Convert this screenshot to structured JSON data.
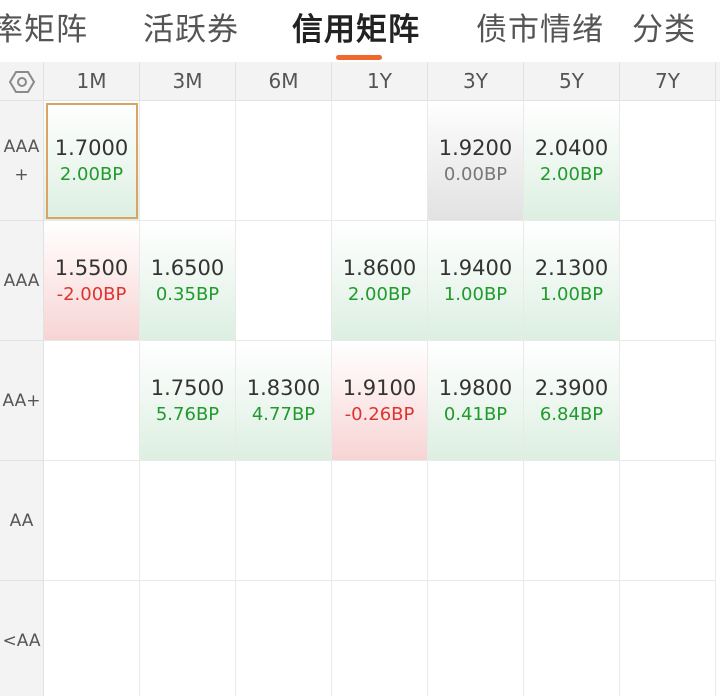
{
  "tabs": [
    {
      "label": "率矩阵"
    },
    {
      "label": "活跃券"
    },
    {
      "label": "信用矩阵"
    },
    {
      "label": "债市情绪"
    },
    {
      "label": "分类"
    }
  ],
  "active_tab": "信用矩阵",
  "header": [
    "1M",
    "3M",
    "6M",
    "1Y",
    "3Y",
    "5Y",
    "7Y"
  ],
  "rows": [
    {
      "label": "AAA +",
      "cells": [
        {
          "value": "1.7000",
          "change": "2.00BP",
          "dir": "up",
          "selected": true
        },
        null,
        null,
        null,
        {
          "value": "1.9200",
          "change": "0.00BP",
          "dir": "flat"
        },
        {
          "value": "2.0400",
          "change": "2.00BP",
          "dir": "up"
        },
        null
      ]
    },
    {
      "label": "AAA",
      "cells": [
        {
          "value": "1.5500",
          "change": "-2.00BP",
          "dir": "down"
        },
        {
          "value": "1.6500",
          "change": "0.35BP",
          "dir": "up"
        },
        null,
        {
          "value": "1.8600",
          "change": "2.00BP",
          "dir": "up"
        },
        {
          "value": "1.9400",
          "change": "1.00BP",
          "dir": "up"
        },
        {
          "value": "2.1300",
          "change": "1.00BP",
          "dir": "up"
        },
        null
      ]
    },
    {
      "label": "AA+",
      "cells": [
        null,
        {
          "value": "1.7500",
          "change": "5.76BP",
          "dir": "up"
        },
        {
          "value": "1.8300",
          "change": "4.77BP",
          "dir": "up"
        },
        {
          "value": "1.9100",
          "change": "-0.26BP",
          "dir": "down"
        },
        {
          "value": "1.9800",
          "change": "0.41BP",
          "dir": "up"
        },
        {
          "value": "2.3900",
          "change": "6.84BP",
          "dir": "up"
        },
        null
      ]
    },
    {
      "label": "AA",
      "cells": [
        null,
        null,
        null,
        null,
        null,
        null,
        null
      ]
    },
    {
      "label": "<AA",
      "cells": [
        null,
        null,
        null,
        null,
        null,
        null,
        null
      ]
    }
  ],
  "colors": {
    "up": "#1f9b2c",
    "down": "#e0332f",
    "flat": "#777777",
    "accent": "#f0682e"
  },
  "icons": {
    "corner": "settings-hex-icon"
  }
}
